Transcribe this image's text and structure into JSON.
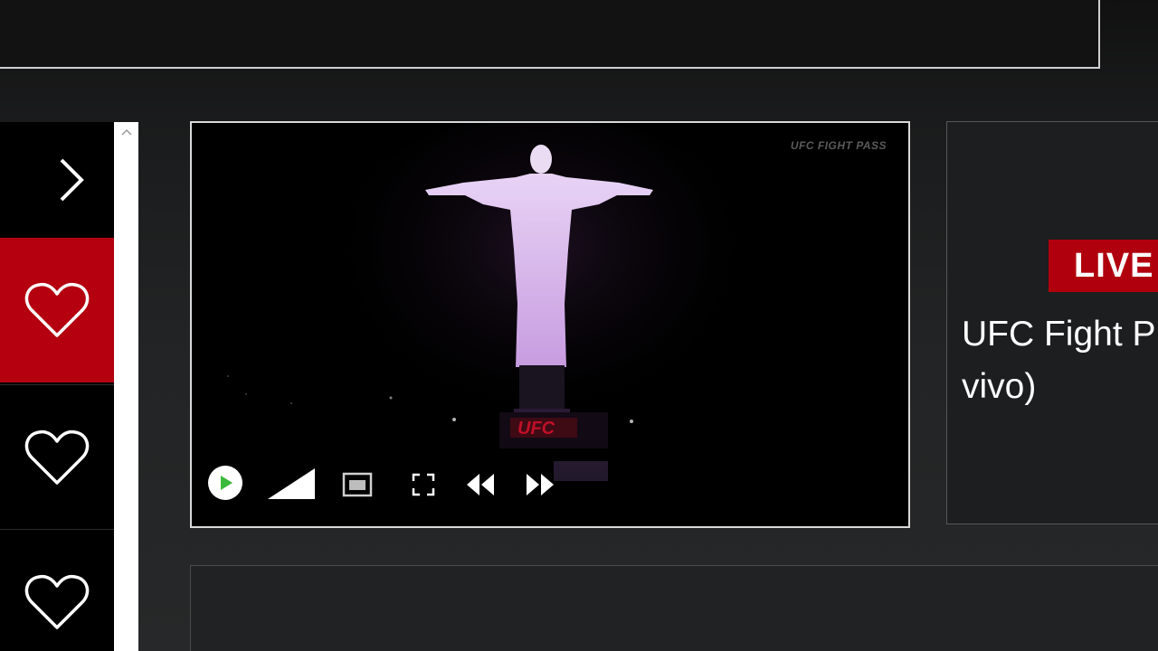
{
  "player": {
    "watermark": "UFC FIGHT PASS",
    "scene_logo": "UFC"
  },
  "card": {
    "live_label": "LIVE",
    "title_line1": "UFC Fight P",
    "title_line2": "vivo)"
  },
  "icons": {
    "next": "chevron-right-icon",
    "favorite": "heart-icon",
    "scroll_up": "chevron-up-icon",
    "play": "play-icon",
    "volume": "volume-icon",
    "pip": "picture-in-picture-icon",
    "fullscreen": "fullscreen-icon",
    "rewind": "rewind-icon",
    "forward": "fast-forward-icon"
  },
  "colors": {
    "accent_red": "#b4000f",
    "live_red": "#b0000e",
    "play_green": "#3cb93c",
    "statue_glow": "#d7b6ee"
  }
}
